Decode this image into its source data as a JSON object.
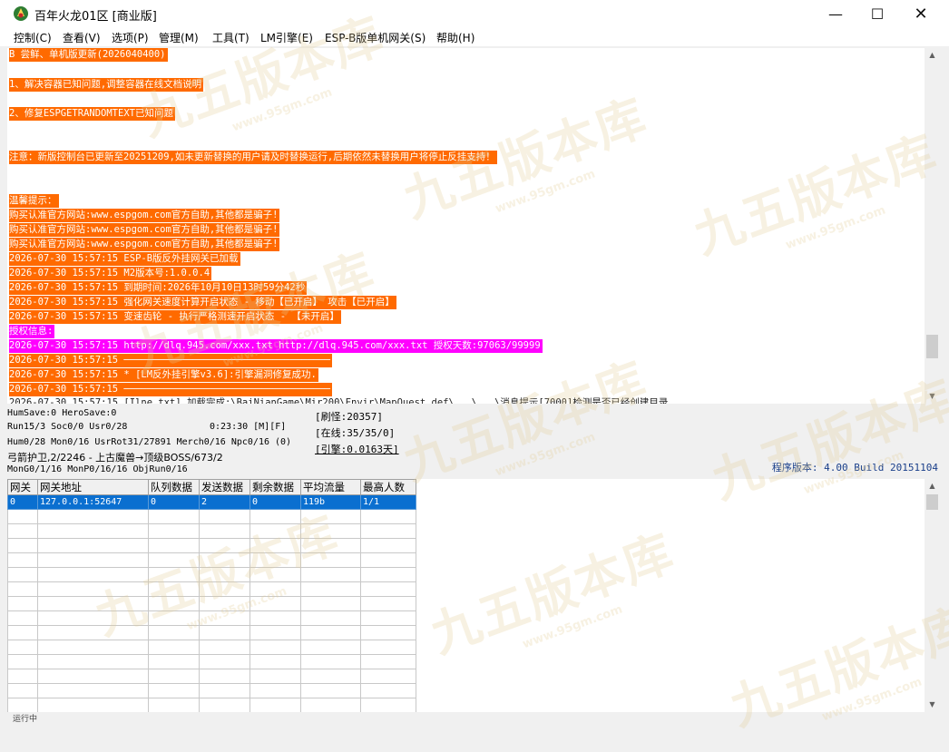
{
  "window": {
    "title": "百年火龙01区 [商业版]",
    "min_icon": "minimize-icon",
    "max_icon": "maximize-icon",
    "close_icon": "close-icon",
    "min_glyph": "—",
    "max_glyph": "☐",
    "close_glyph": "✕"
  },
  "menu": [
    {
      "label": "控制(C)"
    },
    {
      "label": "查看(V)"
    },
    {
      "label": "选项(P)"
    },
    {
      "label": "管理(M)"
    },
    {
      "label": "工具(T)"
    },
    {
      "label": "LM引擎(E)"
    },
    {
      "label": "ESP-B版单机网关(S)"
    },
    {
      "label": "帮助(H)"
    }
  ],
  "log": [
    {
      "text": "B 尝鲜、单机版更新(2026040400)",
      "style": "orange"
    },
    {
      "text": "1、解决容器已知问题,调整容器在线文档说明",
      "style": "orange"
    },
    {
      "text": "2、修复ESPGETRANDOMTEXT已知问题",
      "style": "orange"
    },
    {
      "text": "注意：新版控制台已更新至20251209,如未更新替换的用户请及时替换运行,后期依然未替换用户将停止反挂支持！",
      "style": "orange"
    },
    {
      "text": "温馨提示：",
      "style": "orange"
    },
    {
      "text": "购买认准官方网站:www.espgom.com官方自助,其他都是骗子!",
      "style": "orange"
    },
    {
      "text": "购买认准官方网站:www.espgom.com官方自助,其他都是骗子!",
      "style": "orange"
    },
    {
      "text": "购买认准官方网站:www.espgom.com官方自助,其他都是骗子!",
      "style": "orange"
    },
    {
      "text": "2026-07-30 15:57:15 ESP-B版反外挂网关已加载",
      "style": "orange"
    },
    {
      "text": "2026-07-30 15:57:15 M2版本号:1.0.0.4",
      "style": "orange"
    },
    {
      "text": "2026-07-30 15:57:15 到期时间:2026年10月10日13时59分42秒",
      "style": "orange"
    },
    {
      "text": "2026-07-30 15:57:15 强化网关速度计算开启状态 - 移动【已开启】 攻击【已开启】",
      "style": "orange"
    },
    {
      "text": "2026-07-30 15:57:15 变速齿轮 - 执行严格测速开启状态 - 【未开启】",
      "style": "orange"
    },
    {
      "text": "授权信息:",
      "style": "magenta"
    },
    {
      "text": "2026-07-30 15:57:15 http://dlq.945.com/xxx.txt http://dlq.945.com/xxx.txt 授权天数:97063/99999",
      "style": "magenta"
    },
    {
      "text": "2026-07-30 15:57:15 ────────────────────────────────────",
      "style": "orange"
    },
    {
      "text": "2026-07-30 15:57:15 * [LM反外挂引擎v3.6]:引擎漏洞修复成功.",
      "style": "orange"
    },
    {
      "text": "2026-07-30 15:57:15 ────────────────────────────────────",
      "style": "orange"
    },
    {
      "text": "2026-07-30 15:57:15 [Ilne.txt] 加载完成:\\BaiNianGame\\Mir200\\Envir\\MapQuest_def\\...\\...\\消息提示[7000]检测是否已经创建目录 ...",
      "style": "plain"
    }
  ],
  "status": {
    "line1": "HumSave:0 HeroSave:0",
    "line2": "Run15/3 Soc0/0 Usr0/28",
    "time": "0:23:30 [M][F]",
    "line3": "Hum0/28 Mon0/16 UsrRot31/27891 Merch0/16 Npc0/16 (0)",
    "line4": "弓箭护卫,2/2246 - 上古魔兽→顶级BOSS/673/2",
    "line5": "MonG0/1/16 MonP0/16/16 ObjRun0/16",
    "refresh": "[刷怪:20357]",
    "online": "[在线:35/35/0]",
    "engine": "[引擎:0.0163天]",
    "version": "程序版本: 4.00 Build 20151104"
  },
  "table": {
    "columns": [
      "网关",
      "网关地址",
      "队列数据",
      "发送数据",
      "剩余数据",
      "平均流量",
      "最高人数"
    ],
    "rows": [
      [
        "0",
        "127.0.0.1:52647",
        "0",
        "2",
        "0",
        "119b",
        "1/1"
      ]
    ],
    "empty_rows": 15
  },
  "watermark": {
    "big": "九五版本库",
    "small": "www.95gm.com"
  },
  "bottom_text": "运行中"
}
